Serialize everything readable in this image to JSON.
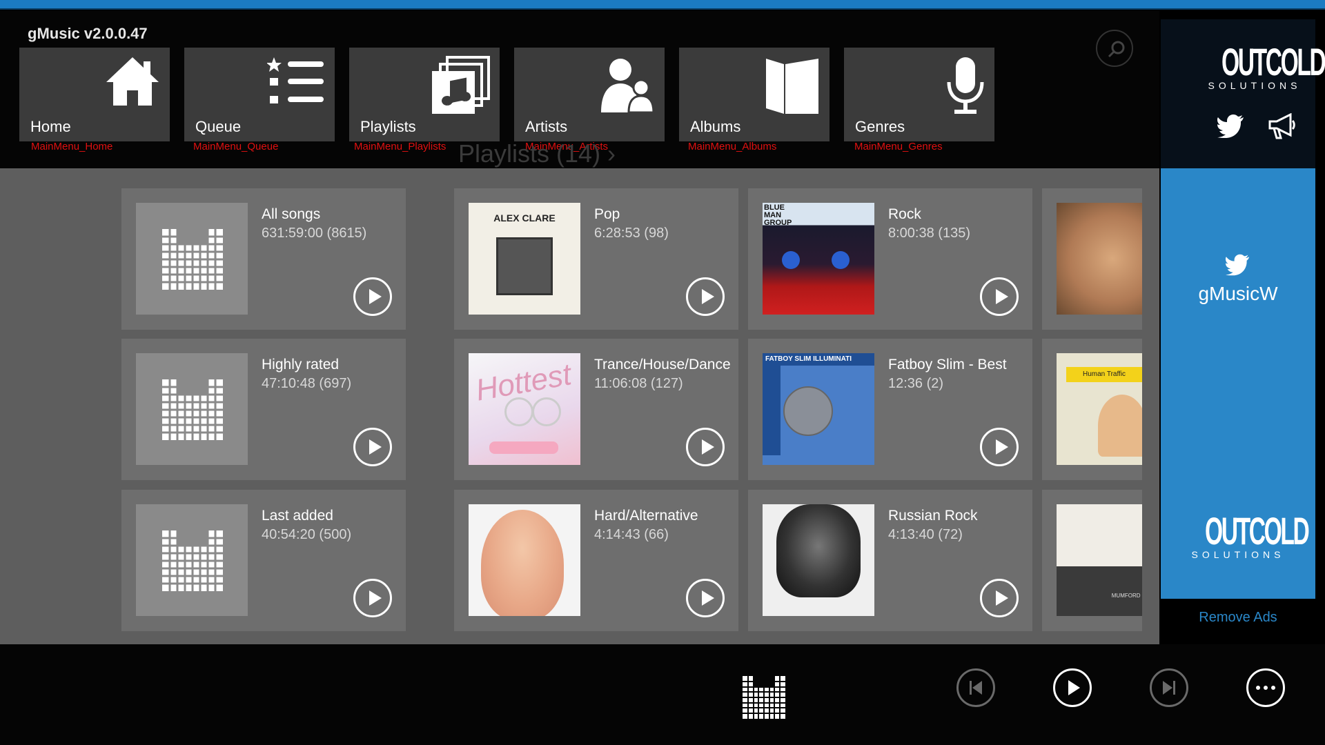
{
  "app": {
    "title": "gMusic v2.0.0.47"
  },
  "menu": [
    {
      "label": "Home",
      "key": "MainMenu_Home",
      "icon": "home-icon"
    },
    {
      "label": "Queue",
      "key": "MainMenu_Queue",
      "icon": "queue-list-icon"
    },
    {
      "label": "Playlists",
      "key": "MainMenu_Playlists",
      "icon": "playlists-icon"
    },
    {
      "label": "Artists",
      "key": "MainMenu_Artists",
      "icon": "artists-icon"
    },
    {
      "label": "Albums",
      "key": "MainMenu_Albums",
      "icon": "album-icon"
    },
    {
      "label": "Genres",
      "key": "MainMenu_Genres",
      "icon": "microphone-icon"
    }
  ],
  "section": {
    "title": "Playlists (14) ›"
  },
  "playlists": [
    {
      "name": "All songs",
      "meta": "631:59:00 (8615)",
      "art": "gmusic-logo"
    },
    {
      "name": "Highly rated",
      "meta": "47:10:48 (697)",
      "art": "gmusic-logo"
    },
    {
      "name": "Last added",
      "meta": "40:54:20 (500)",
      "art": "gmusic-logo"
    },
    {
      "name": "Pop",
      "meta": "6:28:53 (98)",
      "art": "album-cover",
      "art_text": "ALEX CLARE"
    },
    {
      "name": "Trance/House/Dance",
      "meta": "11:06:08 (127)",
      "art": "album-cover",
      "art_text": "Hottest"
    },
    {
      "name": "Hard/Alternative",
      "meta": "4:14:43 (66)",
      "art": "album-cover",
      "art_text": ""
    },
    {
      "name": "Rock",
      "meta": "8:00:38 (135)",
      "art": "album-cover",
      "art_text": "BLUE MAN GROUP"
    },
    {
      "name": "Fatboy Slim - Best",
      "meta": "12:36 (2)",
      "art": "album-cover",
      "art_text": "FATBOY SLIM ILLUMINATI"
    },
    {
      "name": "Russian Rock",
      "meta": "4:13:40 (72)",
      "art": "album-cover",
      "art_text": ""
    },
    {
      "name": "",
      "meta": "",
      "art": "album-cover",
      "art_text": ""
    },
    {
      "name": "",
      "meta": "",
      "art": "album-cover",
      "art_text": "Human Traffic"
    },
    {
      "name": "",
      "meta": "",
      "art": "album-cover",
      "art_text": "MUMFORD & SONS"
    }
  ],
  "side": {
    "brand_big": "OUTCOLD",
    "brand_small": "SOLUTIONS",
    "twitter_handle": "gMusicW",
    "remove_ads": "Remove Ads"
  },
  "colors": {
    "accent": "#2a87c8",
    "menu_key": "#e01010",
    "tile": "#3b3b3b",
    "card": "#6e6e6e",
    "content_bg": "#5e5e5e"
  },
  "player": {
    "controls": [
      "previous-icon",
      "play-icon",
      "next-icon",
      "more-icon"
    ]
  }
}
